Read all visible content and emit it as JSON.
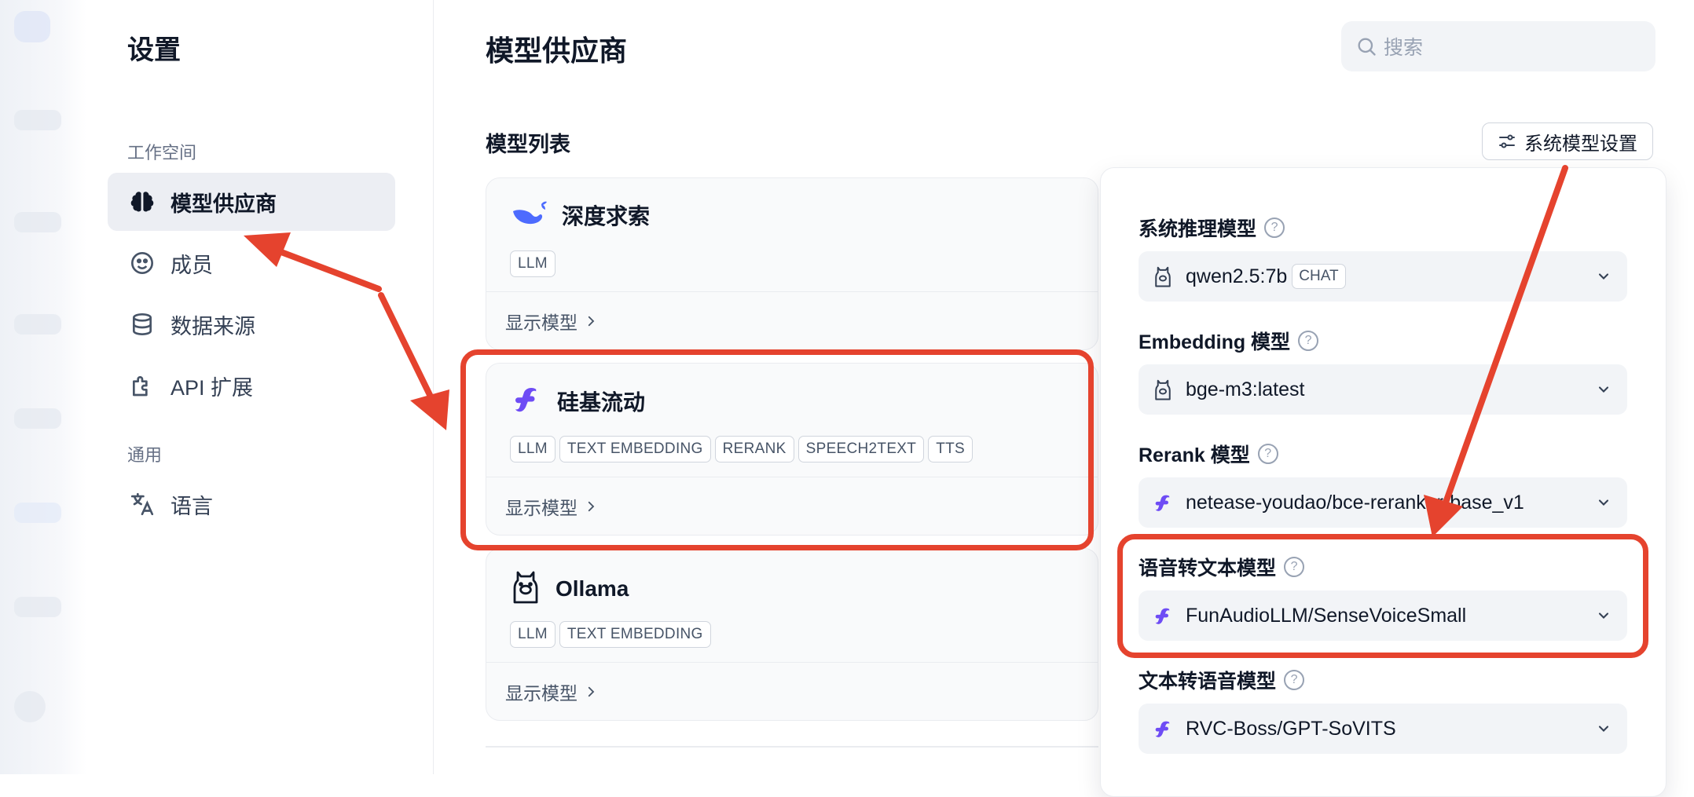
{
  "sidebar": {
    "title": "设置",
    "groups": [
      {
        "label": "工作空间"
      },
      {
        "label": "通用"
      }
    ],
    "items": [
      {
        "label": "模型供应商",
        "icon": "brain-icon",
        "active": true
      },
      {
        "label": "成员",
        "icon": "members-icon"
      },
      {
        "label": "数据来源",
        "icon": "database-icon"
      },
      {
        "label": "API 扩展",
        "icon": "puzzle-icon"
      },
      {
        "label": "语言",
        "icon": "translate-icon"
      }
    ]
  },
  "header": {
    "title": "模型供应商",
    "search_placeholder": "搜索"
  },
  "model_list": {
    "title": "模型列表",
    "system_settings_button": "系统模型设置",
    "providers": [
      {
        "name": "深度求索",
        "tags": [
          "LLM"
        ],
        "footer": "显示模型",
        "icon": "deepseek-whale-icon",
        "highlighted": false
      },
      {
        "name": "硅基流动",
        "tags": [
          "LLM",
          "TEXT EMBEDDING",
          "RERANK",
          "SPEECH2TEXT",
          "TTS"
        ],
        "footer": "显示模型",
        "icon": "siliconflow-icon",
        "highlighted": true
      },
      {
        "name": "Ollama",
        "tags": [
          "LLM",
          "TEXT EMBEDDING"
        ],
        "footer": "显示模型",
        "icon": "ollama-llama-icon",
        "highlighted": false
      }
    ]
  },
  "system_model_panel": {
    "fields": [
      {
        "label": "系统推理模型",
        "value": "qwen2.5:7b",
        "badge": "CHAT",
        "provider_icon": "ollama-llama-icon"
      },
      {
        "label": "Embedding 模型",
        "value": "bge-m3:latest",
        "provider_icon": "ollama-llama-icon"
      },
      {
        "label": "Rerank 模型",
        "value": "netease-youdao/bce-reranker-base_v1",
        "provider_icon": "siliconflow-icon"
      },
      {
        "label": "语音转文本模型",
        "value": "FunAudioLLM/SenseVoiceSmall",
        "provider_icon": "siliconflow-icon",
        "highlighted": true
      },
      {
        "label": "文本转语音模型",
        "value": "RVC-Boss/GPT-SoVITS",
        "provider_icon": "siliconflow-icon"
      }
    ],
    "help_glyph": "?"
  },
  "colors": {
    "annotation_red": "#e5432e",
    "siliconflow_purple": "#6e4cf5",
    "deepseek_blue": "#4d6bfe",
    "active_nav_bg": "#eceef3"
  }
}
